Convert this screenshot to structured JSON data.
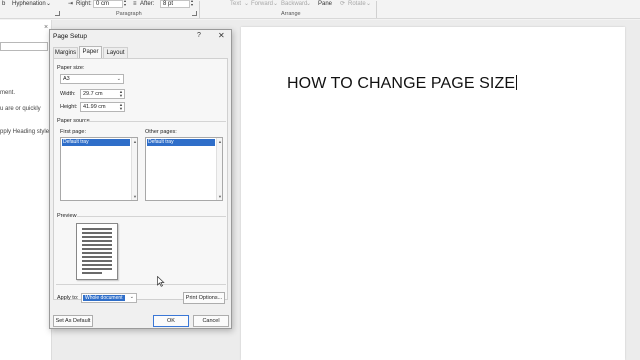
{
  "ribbon": {
    "hyphenation": "Hyphenation",
    "right_label": "Right:",
    "right_value": "0 cm",
    "after_label": "After:",
    "after_value": "8 pt",
    "paragraph_group": "Paragraph",
    "forward": "Forward",
    "backward": "Backward",
    "pane": "Pane",
    "rotate": "Rotate",
    "text_cut": "Text",
    "arrange_group": "Arrange"
  },
  "navpane": {
    "line1": "ment.",
    "line2": "u are or quickly",
    "line3": "pply Heading styles"
  },
  "document": {
    "title": "HOW TO CHANGE PAGE SIZE"
  },
  "dialog": {
    "title": "Page Setup",
    "help": "?",
    "close": "✕",
    "tabs": [
      "Margins",
      "Paper",
      "Layout"
    ],
    "active_tab": "Paper",
    "paper_size_label": "Paper size:",
    "paper_size_value": "A3",
    "width_label": "Width:",
    "width_value": "29.7 cm",
    "height_label": "Height:",
    "height_value": "41.99 cm",
    "paper_source_label": "Paper source",
    "first_page_label": "First page:",
    "other_pages_label": "Other pages:",
    "first_page_selected": "Default tray",
    "other_pages_selected": "Default tray",
    "preview_label": "Preview",
    "apply_to_label": "Apply to:",
    "apply_to_value": "Whole document",
    "print_options": "Print Options...",
    "set_as_default": "Set As Default",
    "ok": "OK",
    "cancel": "Cancel"
  },
  "colors": {
    "selection": "#2f6ec9",
    "primary_border": "#3a77d6"
  }
}
